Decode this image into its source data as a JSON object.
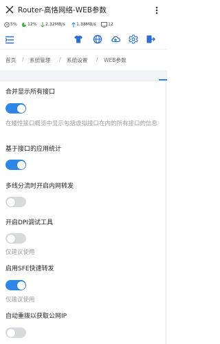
{
  "window": {
    "title": "Router-高恪网络-WEB参数"
  },
  "status": {
    "cpu": "5%",
    "mem": "12%",
    "down": "2.32MB/s",
    "up": "1.38MB/s",
    "clients": "12"
  },
  "breadcrumb": {
    "items": [
      "首页",
      "系统管理",
      "系统设置",
      "WEB参数"
    ],
    "separator": "/"
  },
  "settings": [
    {
      "label": "合并显示所有接口",
      "enabled": true,
      "description": "在矮性接口概览中显示包括虚拟接口在内的所有接口的信息"
    },
    {
      "label": "基于接口的应用统计",
      "enabled": true,
      "description": ""
    },
    {
      "label": "多线分流时开启内网转发",
      "enabled": false,
      "description": ""
    },
    {
      "label": "开启DPI调试工具",
      "enabled": false,
      "description": "仅建议使用"
    },
    {
      "label": "启用SFE快速转发",
      "enabled": true,
      "description": "仅建议使用"
    },
    {
      "label": "自动重拨以获取公网IP",
      "enabled": false,
      "description": ""
    }
  ],
  "colors": {
    "accent": "#2e86e8",
    "toggle_off": "#d8dadd"
  },
  "icons": [
    "close-icon",
    "more-icon",
    "menu-icon",
    "shirt-icon",
    "globe-icon",
    "cloud-upload-icon",
    "gear-icon",
    "logout-icon"
  ]
}
